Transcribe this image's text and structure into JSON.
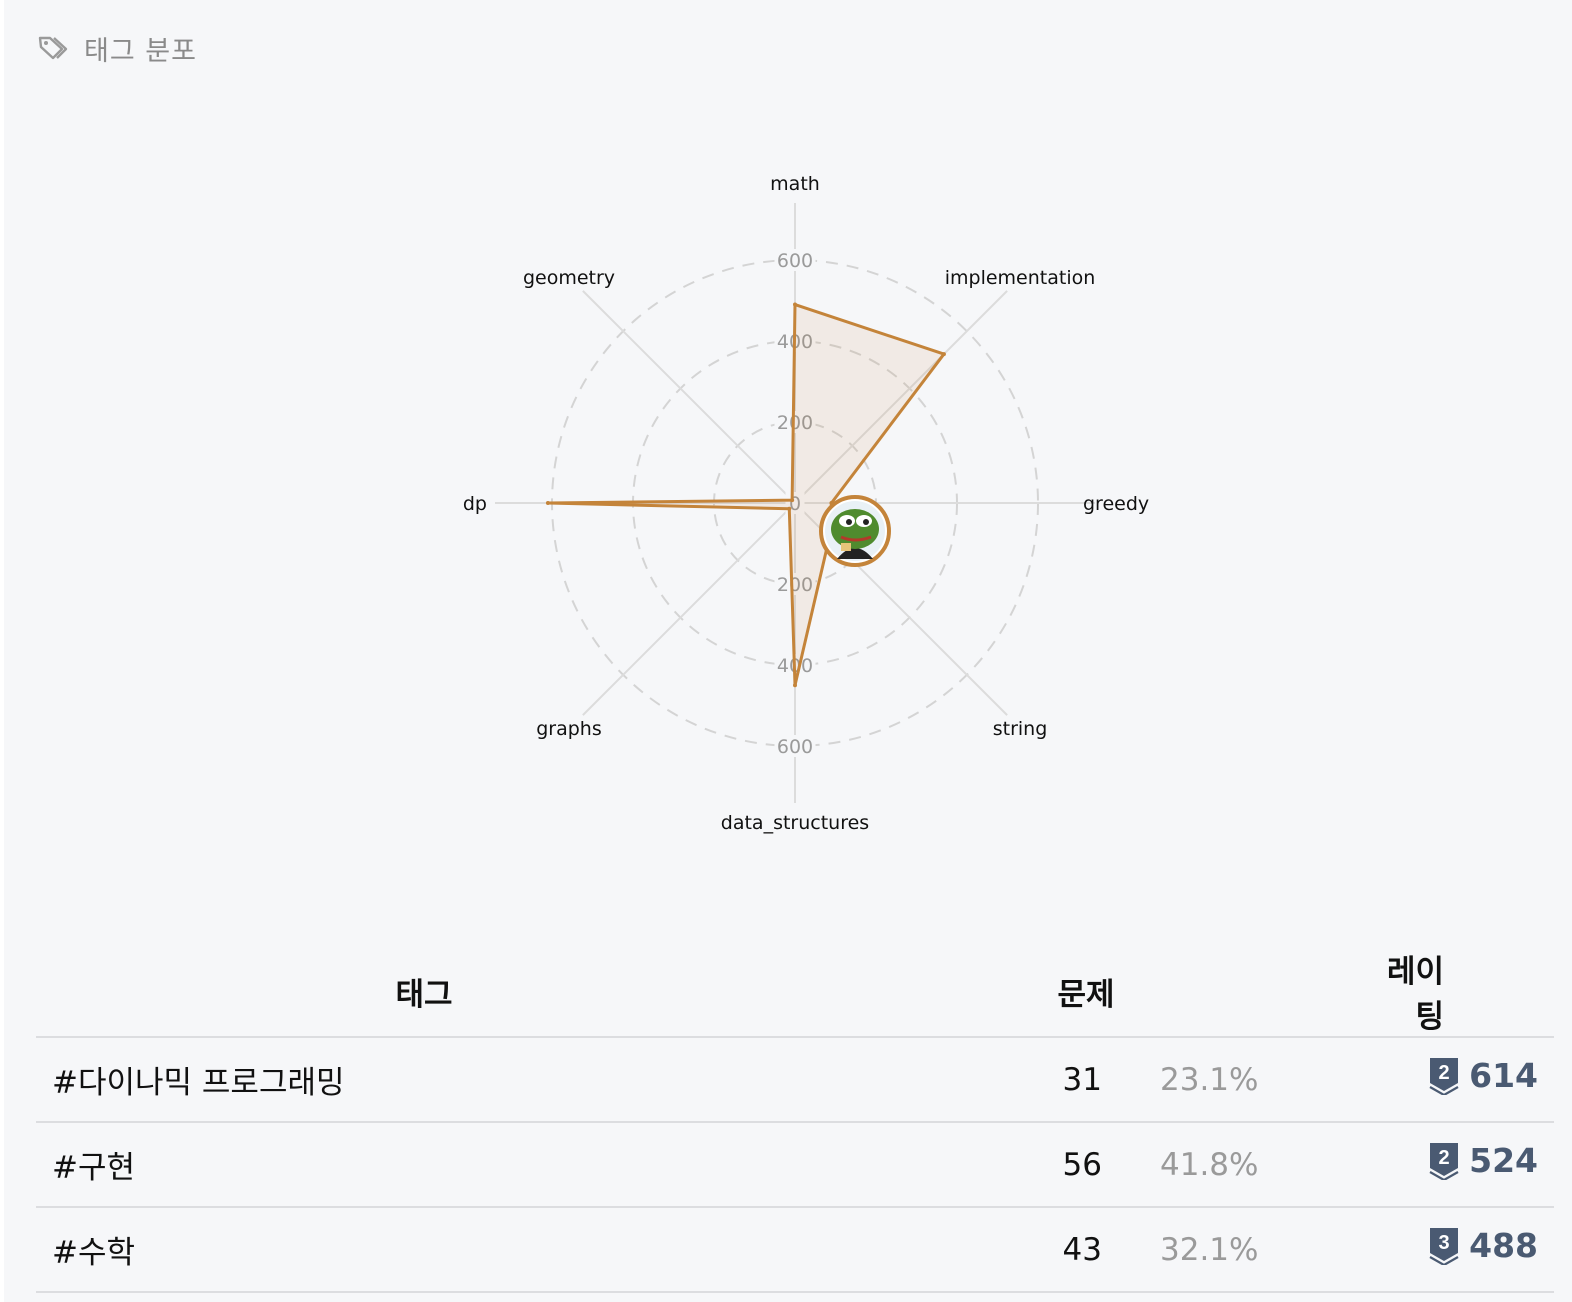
{
  "header": {
    "icon": "tags-icon",
    "title": "태그 분포"
  },
  "chart_data": {
    "type": "radar",
    "axes": [
      "math",
      "implementation",
      "greedy",
      "string",
      "data_structures",
      "graphs",
      "dp",
      "geometry"
    ],
    "values": [
      490,
      520,
      90,
      120,
      450,
      20,
      610,
      10
    ],
    "tick_labels": [
      "0",
      "200",
      "200",
      "400",
      "400",
      "600",
      "600"
    ],
    "ticks": [
      0,
      200,
      400,
      600
    ],
    "range": [
      0,
      600
    ],
    "grid": "dashed-circles",
    "series_color": "#c4843a",
    "avatar": "frog-avatar"
  },
  "table": {
    "headers": {
      "tag": "태그",
      "problems": "문제",
      "rating": "레이팅"
    },
    "rows": [
      {
        "tag": "#다이나믹 프로그래밍",
        "count": "31",
        "percent": "23.1%",
        "tier": "2",
        "rating": "614"
      },
      {
        "tag": "#구현",
        "count": "56",
        "percent": "41.8%",
        "tier": "2",
        "rating": "524"
      },
      {
        "tag": "#수학",
        "count": "43",
        "percent": "32.1%",
        "tier": "3",
        "rating": "488"
      }
    ]
  },
  "colors": {
    "tier_badge": "#4a5a72",
    "accent": "#c4843a"
  }
}
